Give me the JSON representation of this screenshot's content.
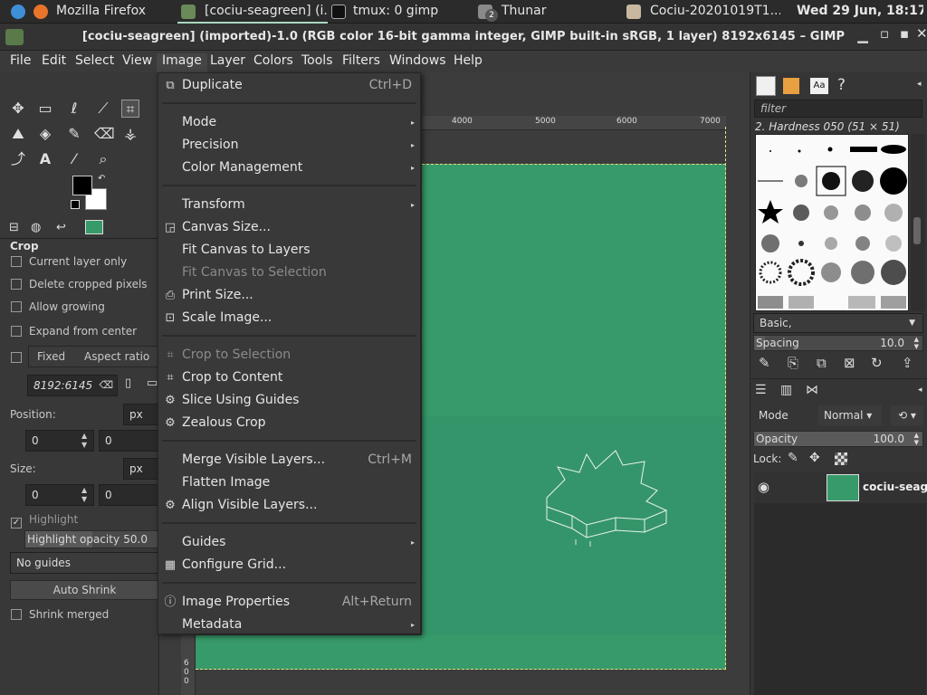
{
  "taskbar": {
    "items": [
      {
        "label": "Mozilla Firefox"
      },
      {
        "label": "[cociu-seagreen] (i..."
      },
      {
        "label": "tmux: 0 gimp"
      },
      {
        "label": "Thunar"
      },
      {
        "label": "Cociu-20201019T1..."
      }
    ],
    "thunar_badge": "2",
    "clock": "Wed 29 Jun, 18:17"
  },
  "window": {
    "title": "[cociu-seagreen] (imported)-1.0 (RGB color 16-bit gamma integer, GIMP built-in sRGB, 1 layer) 8192x6145 – GIMP"
  },
  "menubar": {
    "items": [
      "File",
      "Edit",
      "Select",
      "View",
      "Image",
      "Layer",
      "Colors",
      "Tools",
      "Filters",
      "Windows",
      "Help"
    ]
  },
  "image_menu": {
    "items": [
      {
        "label": "Duplicate",
        "shortcut": "Ctrl+D",
        "icon": "duplicate-icon"
      },
      {
        "label": "Mode",
        "submenu": true
      },
      {
        "label": "Precision",
        "submenu": true
      },
      {
        "label": "Color Management",
        "submenu": true
      },
      {
        "label": "Transform",
        "submenu": true
      },
      {
        "label": "Canvas Size...",
        "icon": "canvas-size-icon"
      },
      {
        "label": "Fit Canvas to Layers"
      },
      {
        "label": "Fit Canvas to Selection",
        "disabled": true
      },
      {
        "label": "Print Size...",
        "icon": "printer-icon"
      },
      {
        "label": "Scale Image...",
        "icon": "scale-image-icon"
      },
      {
        "label": "Crop to Selection",
        "disabled": true,
        "icon": "crop-icon"
      },
      {
        "label": "Crop to Content",
        "icon": "crop-icon"
      },
      {
        "label": "Slice Using Guides",
        "icon": "slice-icon"
      },
      {
        "label": "Zealous Crop",
        "icon": "plugin-icon"
      },
      {
        "label": "Merge Visible Layers...",
        "shortcut": "Ctrl+M"
      },
      {
        "label": "Flatten Image"
      },
      {
        "label": "Align Visible Layers...",
        "icon": "plugin-icon"
      },
      {
        "label": "Guides",
        "submenu": true
      },
      {
        "label": "Configure Grid...",
        "icon": "grid-icon"
      },
      {
        "label": "Image Properties",
        "shortcut": "Alt+Return",
        "icon": "info-icon"
      },
      {
        "label": "Metadata",
        "submenu": true
      }
    ]
  },
  "tool_options": {
    "title": "Crop",
    "current_layer_only": "Current layer only",
    "delete_cropped": "Delete cropped pixels",
    "allow_growing": "Allow growing",
    "expand_from_center": "Expand from center",
    "fixed": "Fixed",
    "aspect_ratio": "Aspect ratio",
    "ratio_value": "8192:6145",
    "position_label": "Position:",
    "position_unit": "px",
    "position_x": "0",
    "position_y": "0",
    "size_label": "Size:",
    "size_unit": "px",
    "size_w": "0",
    "size_h": "0",
    "highlight": "Highlight",
    "highlight_opacity_label": "Highlight opacity",
    "highlight_opacity_value": "50.0",
    "guides": "No guides",
    "auto_shrink": "Auto Shrink",
    "shrink_merged": "Shrink merged"
  },
  "rulers": {
    "h_ticks": [
      "4000",
      "5000",
      "6000",
      "7000"
    ],
    "v_ticks": [
      "6",
      "0",
      "0"
    ]
  },
  "brushes": {
    "filter_placeholder": "filter",
    "selected": "2. Hardness 050 (51 × 51)",
    "preset": "Basic,",
    "spacing_label": "Spacing",
    "spacing_value": "10.0"
  },
  "layers": {
    "mode_label": "Mode",
    "mode_value": "Normal",
    "opacity_label": "Opacity",
    "opacity_value": "100.0",
    "lock_label": "Lock:",
    "layer_name": "cociu-seag"
  },
  "colors": {
    "canvas_green": "#379a6a",
    "accent": "#a8d8c0"
  }
}
